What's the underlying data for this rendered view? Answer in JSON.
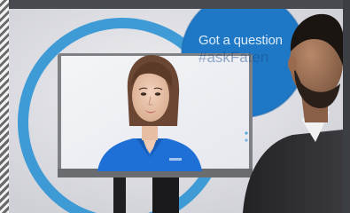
{
  "image": {
    "description_tag": "photo",
    "sign": {
      "line1": "Got a question",
      "line2": "#askFaten"
    },
    "colors": {
      "wall": "#e3e3e8",
      "sign_ring": "#2b8fd0",
      "sign_circle": "#1c6fc0",
      "shirt": "#1e6fd6",
      "suit": "#2b2b2e"
    }
  }
}
